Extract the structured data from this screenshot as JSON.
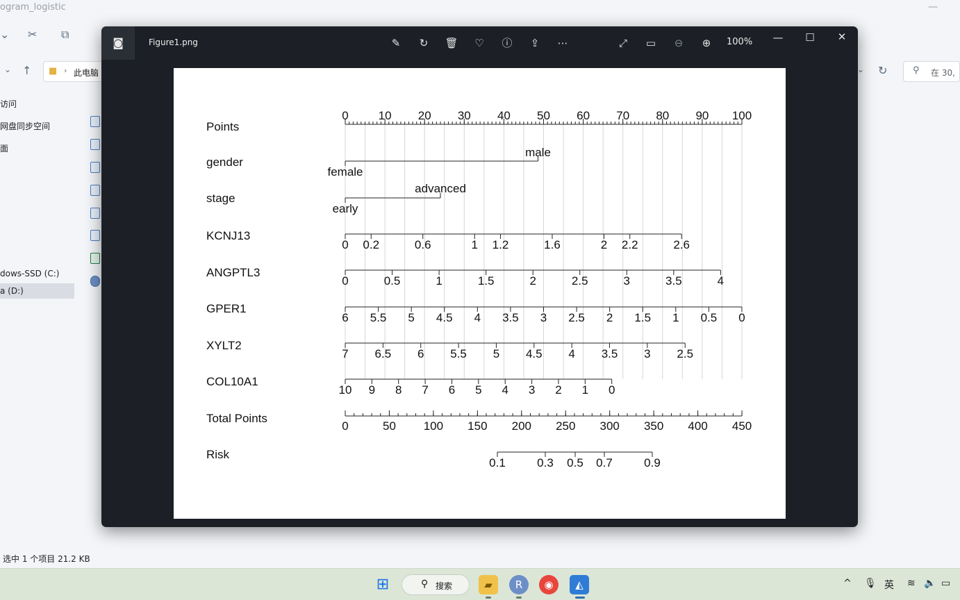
{
  "explorer": {
    "title": "ogram_logistic",
    "address_crumb": "此电脑",
    "search_placeholder": "在 30,",
    "nav_items": [
      "访问",
      "网盘同步空间",
      "面",
      "",
      "",
      "",
      "",
      "",
      "dows-SSD (C:)",
      "a (D:)"
    ],
    "status": "选中 1 个项目  21.2 KB"
  },
  "viewer": {
    "filename": "Figure1.png",
    "zoom": "100%",
    "toolbar_icons": [
      "edit-image-icon",
      "rotate-icon",
      "delete-icon",
      "favorite-icon",
      "info-icon",
      "share-icon",
      "more-icon"
    ],
    "view_icons": [
      "fullscreen-icon",
      "fit-icon",
      "zoom-out-icon",
      "zoom-in-icon"
    ],
    "window_icons": [
      "minimize-icon",
      "maximize-icon",
      "close-icon"
    ]
  },
  "nomogram": {
    "rows": [
      {
        "name": "Points",
        "labels": [
          "0",
          "10",
          "20",
          "30",
          "40",
          "50",
          "60",
          "70",
          "80",
          "90",
          "100"
        ]
      },
      {
        "name": "gender",
        "labels": [
          "female",
          "male"
        ]
      },
      {
        "name": "stage",
        "labels": [
          "early",
          "advanced"
        ]
      },
      {
        "name": "KCNJ13",
        "labels": [
          "0",
          "0.2",
          "0.6",
          "1",
          "1.2",
          "1.6",
          "2",
          "2.2",
          "2.6"
        ]
      },
      {
        "name": "ANGPTL3",
        "labels": [
          "0",
          "0.5",
          "1",
          "1.5",
          "2",
          "2.5",
          "3",
          "3.5",
          "4"
        ]
      },
      {
        "name": "GPER1",
        "labels": [
          "6",
          "5.5",
          "5",
          "4.5",
          "4",
          "3.5",
          "3",
          "2.5",
          "2",
          "1.5",
          "1",
          "0.5",
          "0"
        ]
      },
      {
        "name": "XYLT2",
        "labels": [
          "7",
          "6.5",
          "6",
          "5.5",
          "5",
          "4.5",
          "4",
          "3.5",
          "3",
          "2.5"
        ]
      },
      {
        "name": "COL10A1",
        "labels": [
          "10",
          "9",
          "8",
          "7",
          "6",
          "5",
          "4",
          "3",
          "2",
          "1",
          "0"
        ]
      },
      {
        "name": "Total Points",
        "labels": [
          "0",
          "50",
          "100",
          "150",
          "200",
          "250",
          "300",
          "350",
          "400",
          "450"
        ]
      },
      {
        "name": "Risk",
        "labels": [
          "0.1",
          "0.3",
          "0.5",
          "0.7",
          "0.9"
        ]
      }
    ]
  },
  "taskbar": {
    "search_label": "搜索",
    "ime": "英",
    "apps": [
      "start-icon",
      "file-explorer-icon",
      "r-icon",
      "chrome-icon",
      "photos-icon"
    ]
  }
}
